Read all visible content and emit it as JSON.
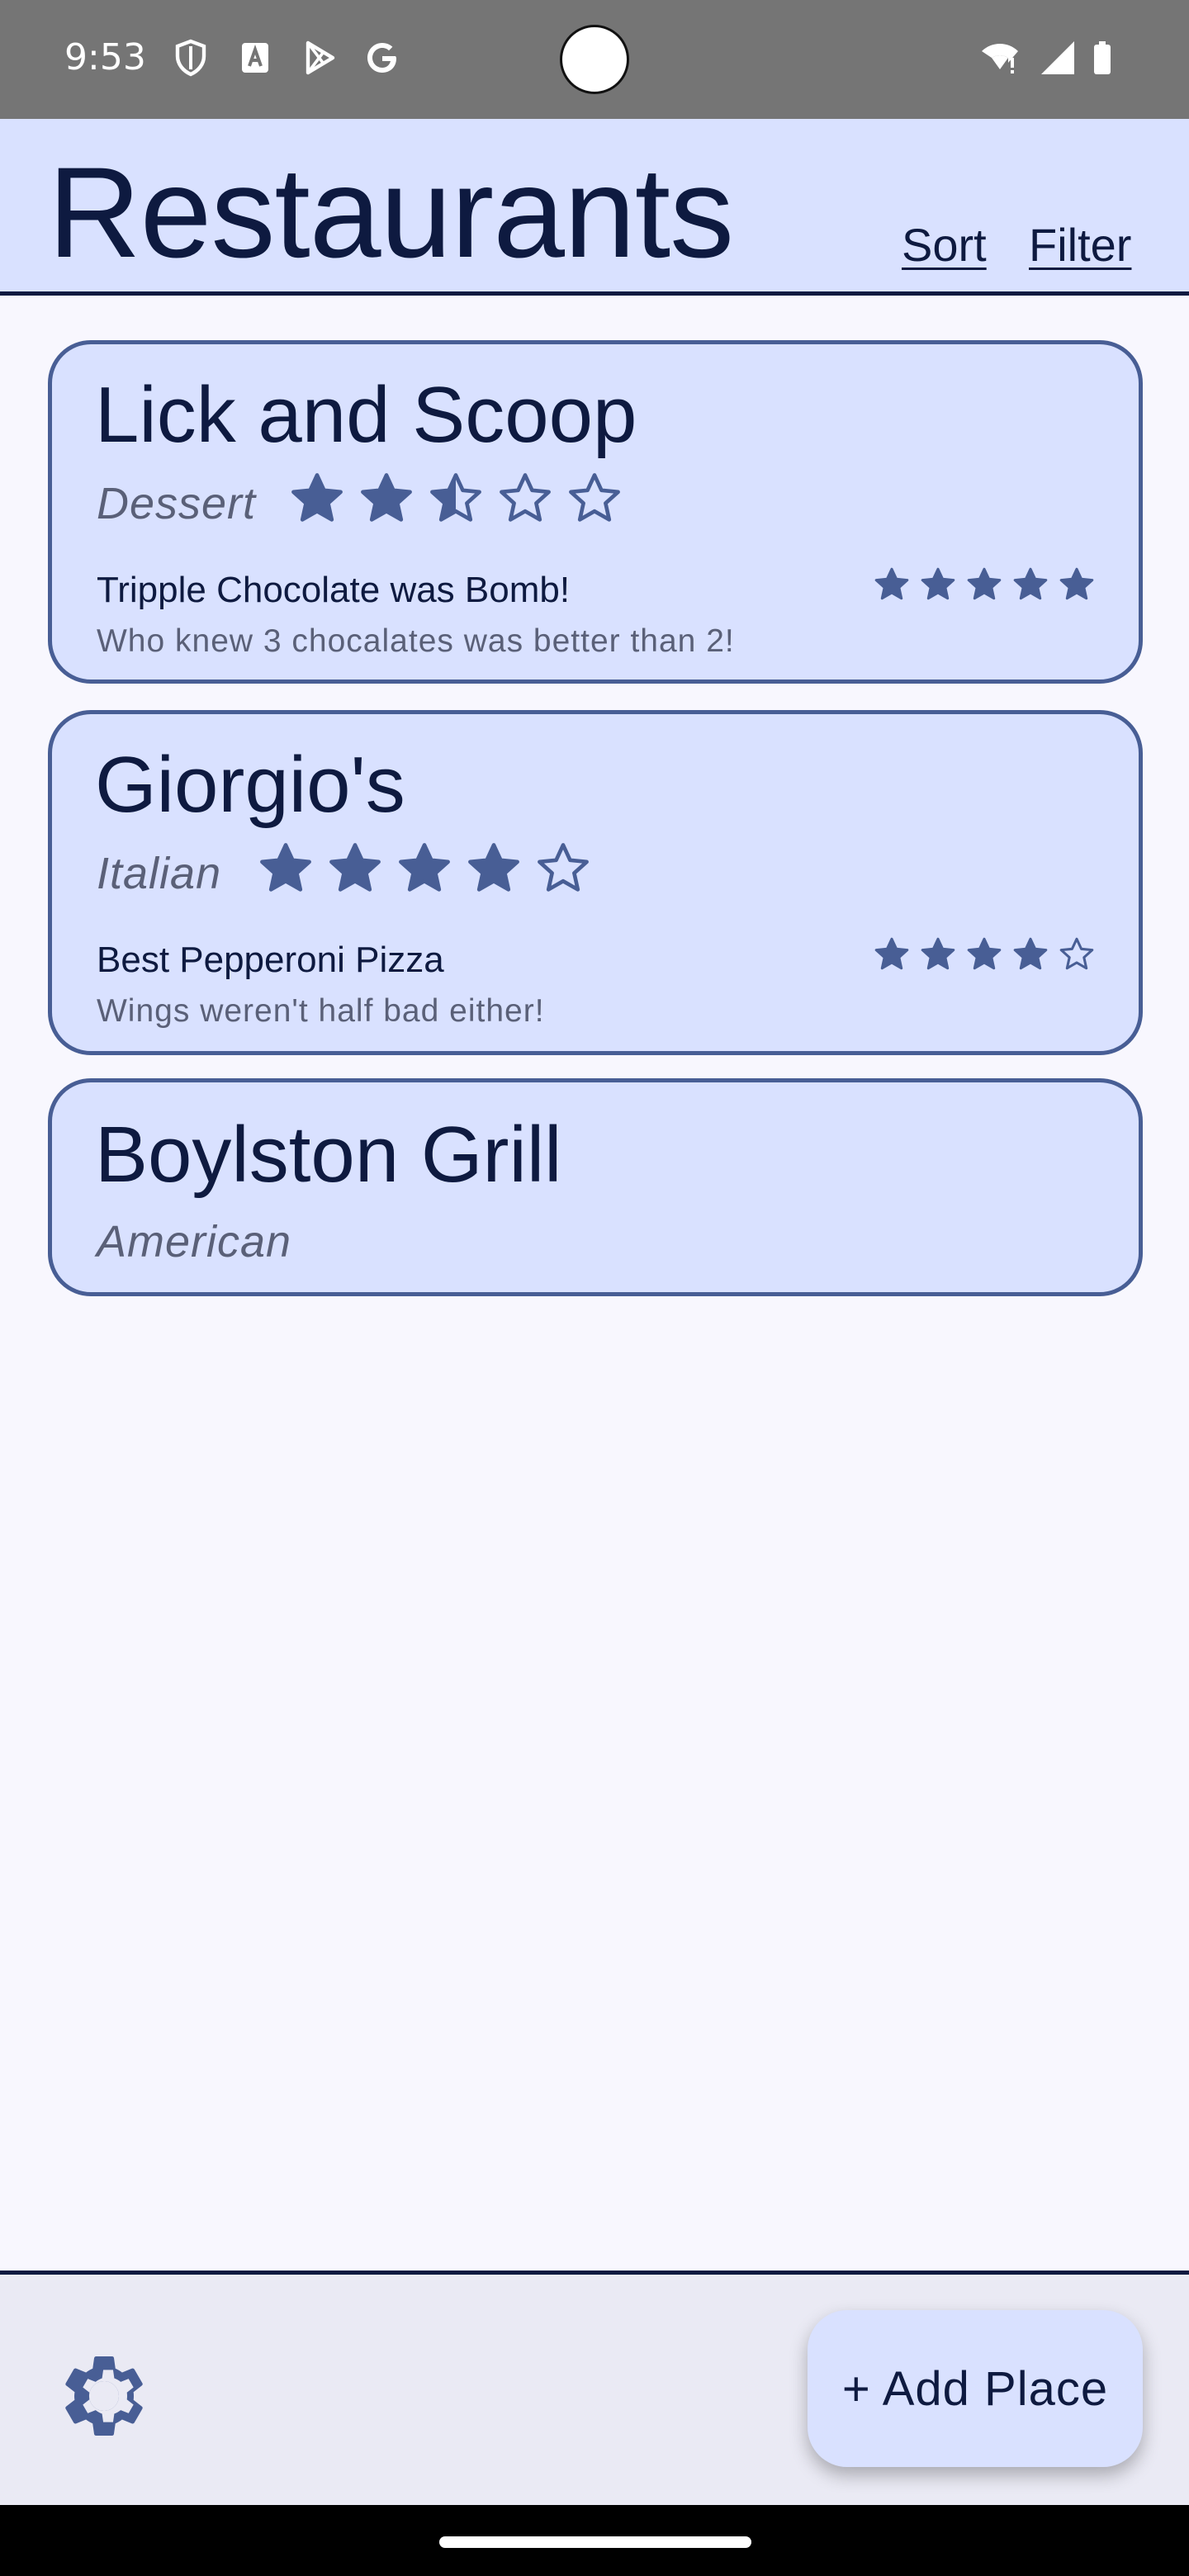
{
  "status_bar": {
    "time": "9:53",
    "left_icons": [
      "shield-icon",
      "font-a-icon",
      "play-store-icon",
      "google-g-icon"
    ],
    "right_icons": [
      "wifi-icon",
      "signal-icon",
      "battery-icon"
    ]
  },
  "header": {
    "title": "Restaurants",
    "sort_label": "Sort",
    "filter_label": "Filter"
  },
  "restaurants": [
    {
      "name": "Lick and Scoop",
      "cuisine": "Dessert",
      "rating": 2.5,
      "review": {
        "title": "Tripple Chocolate was Bomb!",
        "body": "Who knew 3 chocalates was better than 2!",
        "rating": 5
      }
    },
    {
      "name": "Giorgio's",
      "cuisine": "Italian",
      "rating": 4,
      "review": {
        "title": "Best Pepperoni Pizza",
        "body": "Wings weren't half bad either!",
        "rating": 4
      }
    },
    {
      "name": "Boylston Grill",
      "cuisine": "American"
    }
  ],
  "footer": {
    "settings_icon": "gear-icon",
    "add_button_label": "+ Add Place"
  },
  "colors": {
    "accent": "#485e95",
    "card_bg": "#d9e1ff",
    "text_dark": "#0e1a40",
    "text_muted": "#5a6078"
  }
}
